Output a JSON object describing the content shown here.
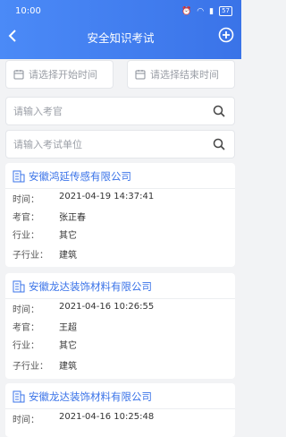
{
  "status": {
    "time": "10:00",
    "battery": "57"
  },
  "header": {
    "title": "安全知识考试"
  },
  "filters": {
    "start_placeholder": "请选择开始时间",
    "end_placeholder": "请选择结束时间",
    "examiner_placeholder": "请输入考官",
    "unit_placeholder": "请输入考试单位"
  },
  "labels": {
    "time": "时间：",
    "examiner": "考官：",
    "industry": "行业：",
    "sub_industry": "子行业："
  },
  "records": [
    {
      "company": "安徽鸿延传感有限公司",
      "time": "2021-04-19 14:37:41",
      "examiner": "张正春",
      "industry": "其它",
      "sub_industry": "建筑"
    },
    {
      "company": "安徽龙达装饰材料有限公司",
      "time": "2021-04-16 10:26:55",
      "examiner": "王超",
      "industry": "其它",
      "sub_industry": "建筑"
    },
    {
      "company": "安徽龙达装饰材料有限公司",
      "time": "2021-04-16 10:25:48"
    }
  ]
}
